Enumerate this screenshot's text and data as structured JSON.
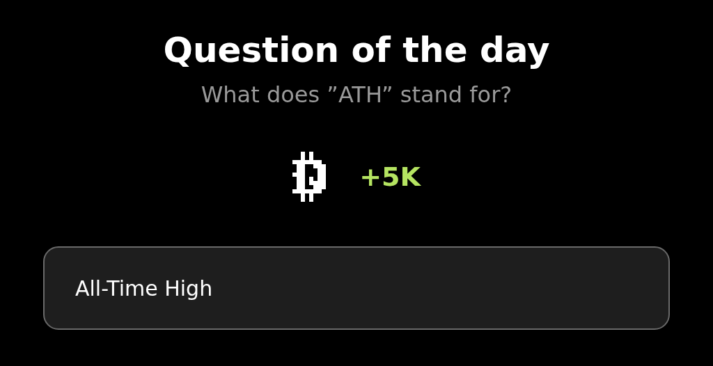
{
  "title": "Question of the day",
  "question": "What does ”ATH” stand for?",
  "reward": "+5K",
  "answers": [
    {
      "label": "All-Time High"
    }
  ]
}
